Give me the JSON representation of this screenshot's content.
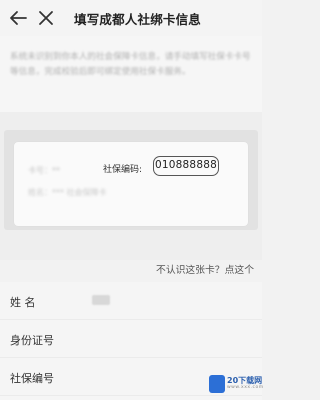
{
  "header": {
    "title": "填写成都人社绑卡信息",
    "back_icon": "arrow-left-icon",
    "close_icon": "close-icon"
  },
  "notice": {
    "text": "系统未识别到你本人的社会保障卡信息，请手动填写社保卡卡号等信息，完成校验后即可绑定使用社保卡服务。"
  },
  "card": {
    "blur_line_1": "卡号：**",
    "blur_line_2": "姓名：*** 社会保障卡",
    "number_label": "社保编码:",
    "number_value": "010888888"
  },
  "help_link": "不认识这张卡？点这个",
  "form": {
    "fields": [
      {
        "label": "姓 名",
        "value": ""
      },
      {
        "label": "身份证号",
        "value": ""
      },
      {
        "label": "社保编号",
        "value": ""
      }
    ]
  },
  "watermark": {
    "text": "20下载网",
    "sub": "www.xxx.com",
    "color": "#2c6fd6"
  },
  "colors": {
    "background": "#f2f2f2",
    "title": "#222222",
    "link": "#555555"
  }
}
